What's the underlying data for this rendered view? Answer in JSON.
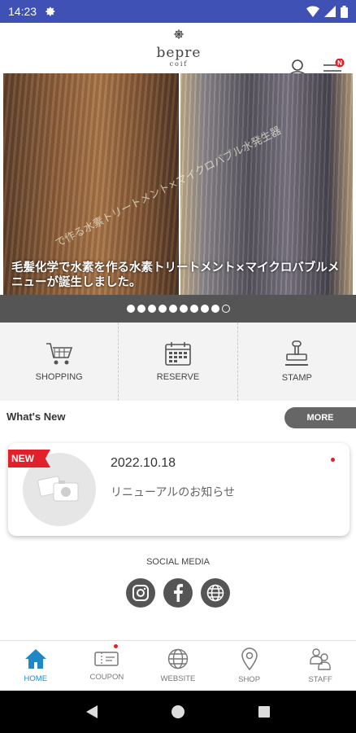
{
  "status_bar": {
    "time": "14:23",
    "icons": [
      "gear-icon",
      "wifi-icon",
      "signal-icon",
      "battery-icon"
    ]
  },
  "header": {
    "logo_text": "bepre",
    "logo_sub": "coif",
    "menu_badge": "N"
  },
  "banner": {
    "caption": "毛髪化学で水素を作る水素トリートメント×マイクロバブルメニューが誕生しました。",
    "overlay_text": "で作る水素トリートメント×マイクロバブル水発生器",
    "slide_count": 10,
    "active_slide": 9
  },
  "quick_menu": [
    {
      "label": "SHOPPING",
      "icon": "cart-icon"
    },
    {
      "label": "RESERVE",
      "icon": "calendar-icon"
    },
    {
      "label": "STAMP",
      "icon": "stamp-icon"
    }
  ],
  "whats_new": {
    "title": "What's New",
    "more_label": "MORE"
  },
  "news": [
    {
      "badge": "NEW",
      "date": "2022.10.18",
      "title": "リニューアルのお知らせ",
      "unread": true
    }
  ],
  "social": {
    "title": "SOCIAL MEDIA",
    "items": [
      "instagram-icon",
      "facebook-icon",
      "website-icon"
    ]
  },
  "bottom_nav": [
    {
      "label": "HOME",
      "icon": "home-icon",
      "active": true
    },
    {
      "label": "COUPON",
      "icon": "coupon-icon",
      "badge": true
    },
    {
      "label": "WEBSITE",
      "icon": "globe-icon"
    },
    {
      "label": "SHOP",
      "icon": "location-pin-icon"
    },
    {
      "label": "STAFF",
      "icon": "staff-icon"
    }
  ],
  "colors": {
    "status_bar": "#3f51b5",
    "accent": "#1f87c4",
    "badge_red": "#e0202a",
    "dark_grey": "#555555"
  }
}
